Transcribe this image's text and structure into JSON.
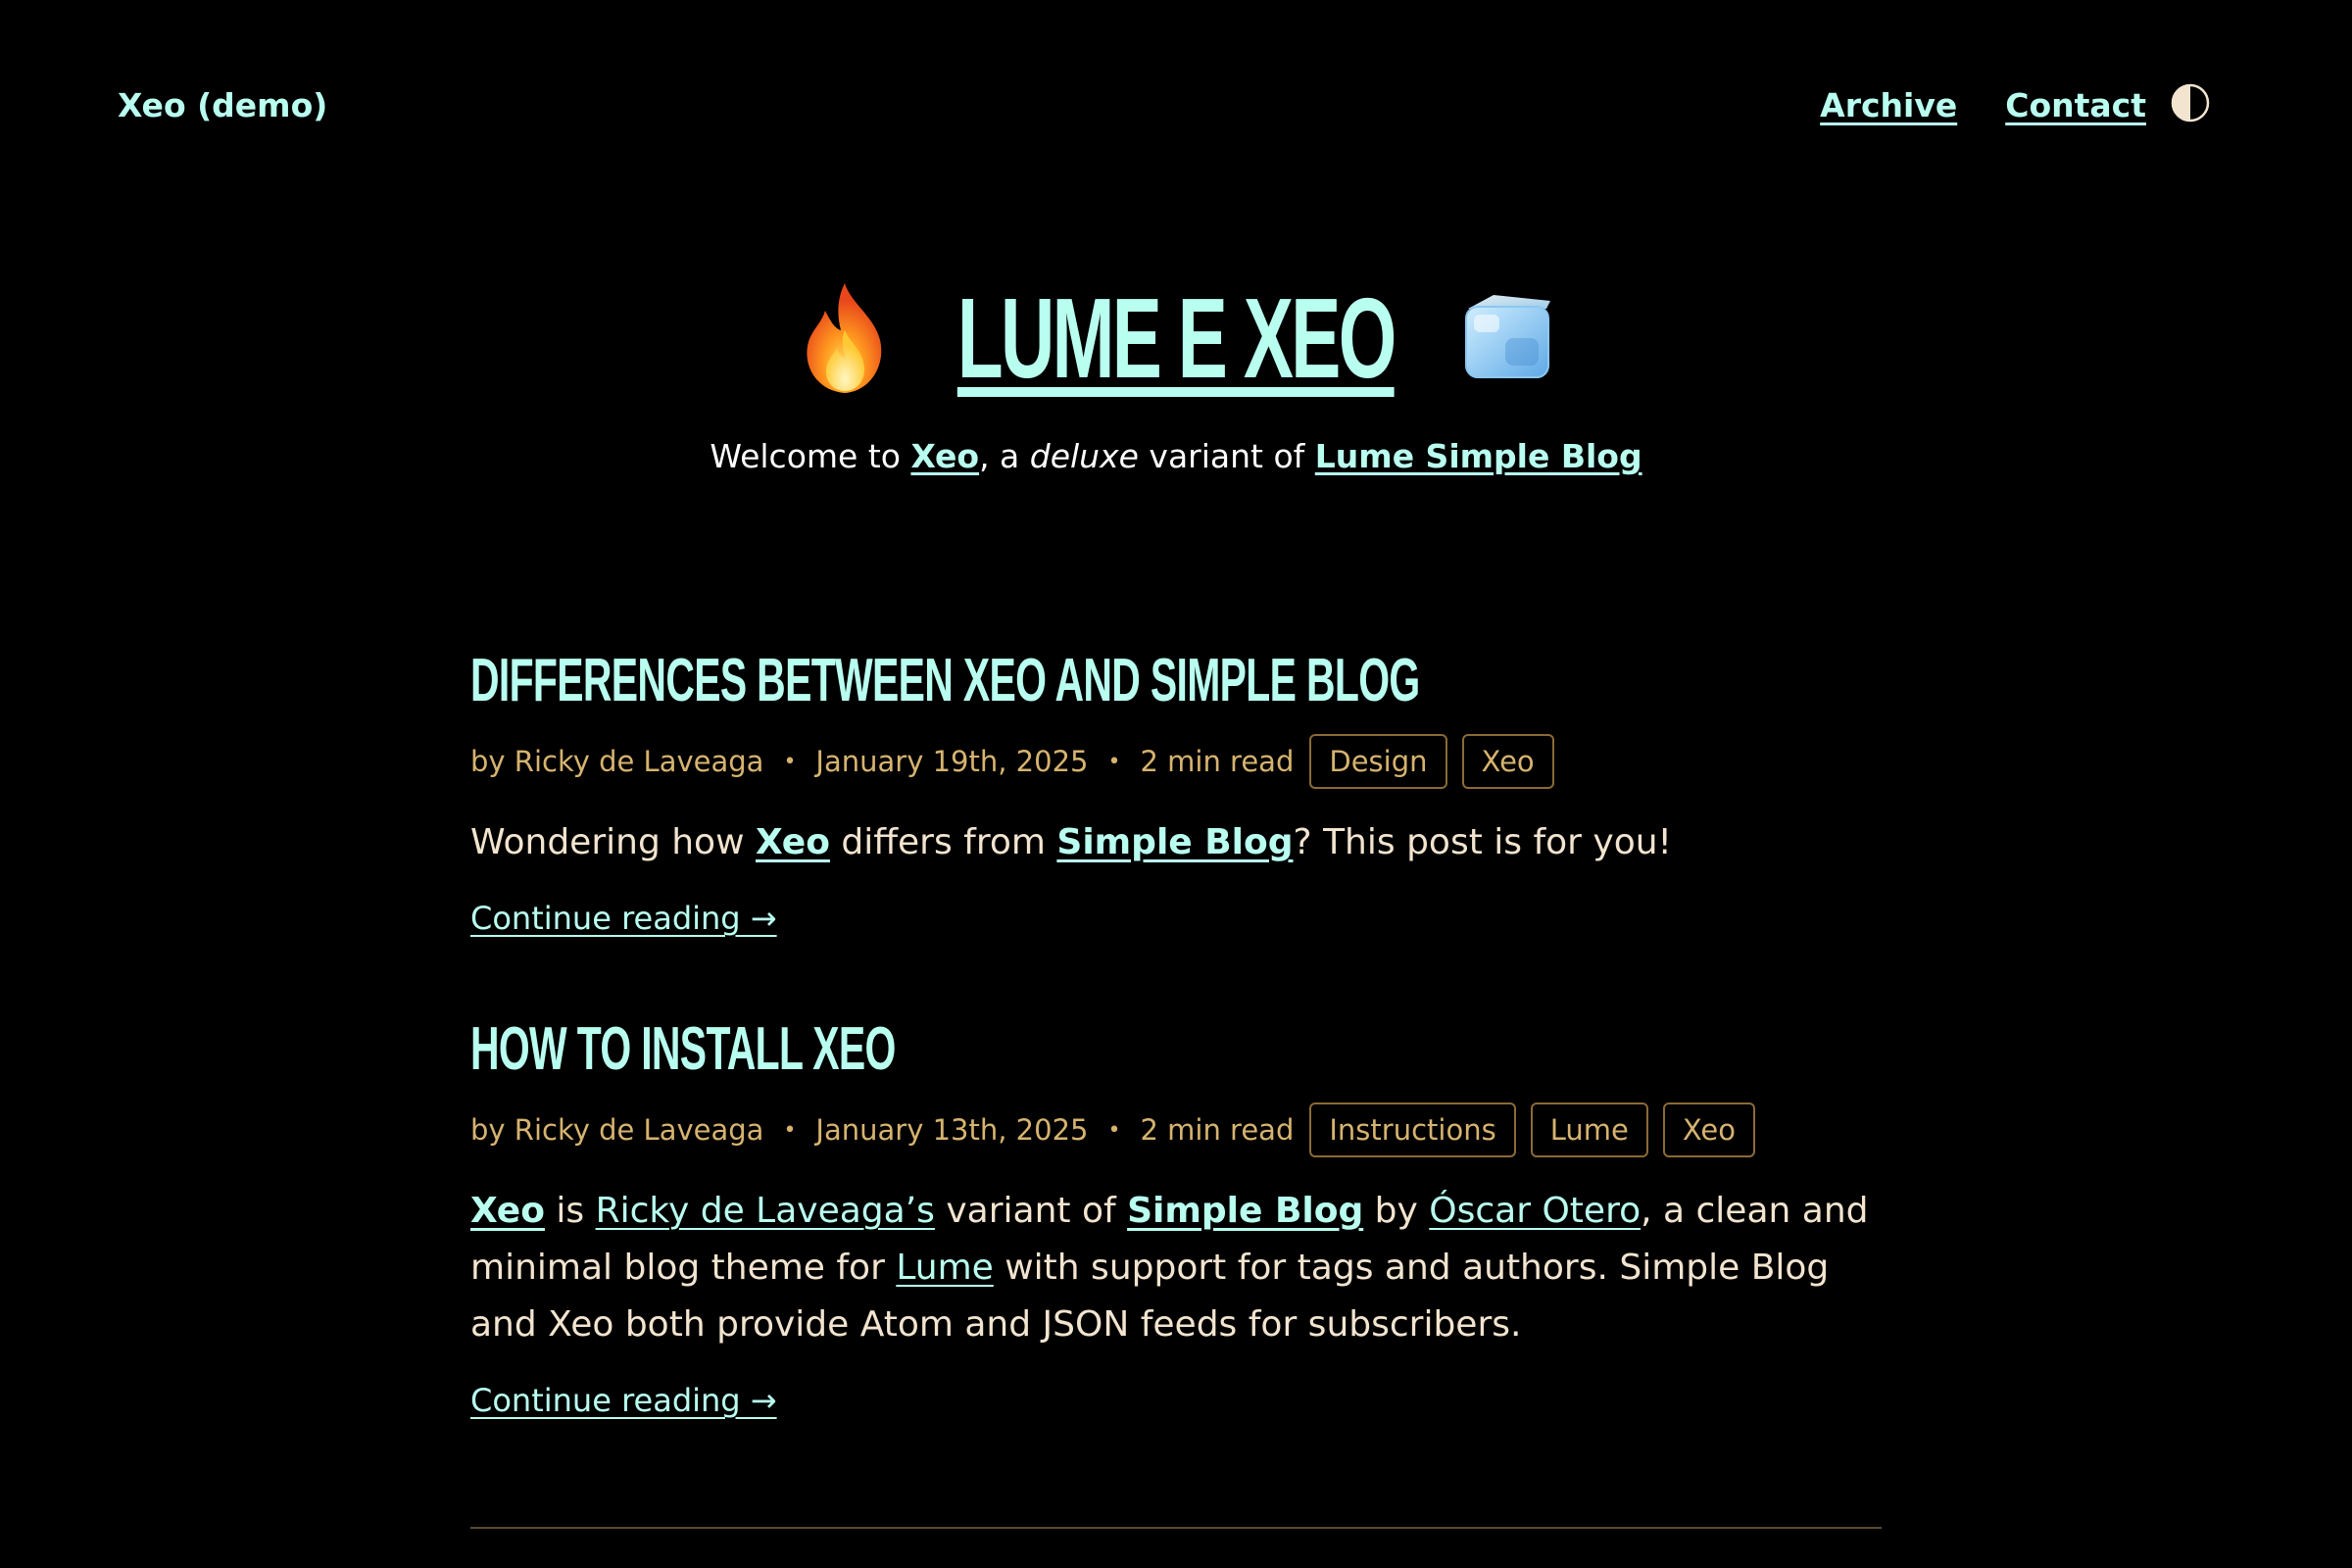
{
  "header": {
    "site_name": "Xeo (demo)",
    "nav": [
      {
        "label": "Archive"
      },
      {
        "label": "Contact"
      }
    ],
    "theme_toggle_icon": "half-circle-contrast-icon"
  },
  "hero": {
    "title": "LUME E XEO",
    "left_icon": "fire-emoji-icon",
    "right_icon": "ice-cube-emoji-icon",
    "sub_pre": "Welcome to ",
    "sub_link1": "Xeo",
    "sub_mid1": ", a ",
    "sub_em": "deluxe",
    "sub_mid2": " variant of ",
    "sub_link2": "Lume Simple Blog"
  },
  "posts": [
    {
      "title": "DIFFERENCES BETWEEN XEO AND SIMPLE BLOG",
      "author": "by Ricky de Laveaga",
      "date": "January 19th, 2025",
      "read_time": "2 min read",
      "tags": [
        "Design",
        "Xeo"
      ],
      "body": {
        "t1": "Wondering how ",
        "l1": "Xeo",
        "t2": " differs from ",
        "l2": "Simple Blog",
        "t3": "? This post is for you!"
      },
      "continue": "Continue reading →"
    },
    {
      "title": "HOW TO INSTALL XEO",
      "author": "by Ricky de Laveaga",
      "date": "January 13th, 2025",
      "read_time": "2 min read",
      "tags": [
        "Instructions",
        "Lume",
        "Xeo"
      ],
      "body": {
        "l1": "Xeo",
        "t1": " is ",
        "l2": "Ricky de Laveaga’s",
        "t2": " variant of ",
        "l3": "Simple Blog",
        "t3": " by ",
        "l4": "Óscar Otero",
        "t4": ", a clean and minimal blog theme for ",
        "l5": "Lume",
        "t5": " with support for tags and authors. Simple Blog and Xeo both provide Atom and JSON feeds for subscribers."
      },
      "continue": "Continue reading →"
    }
  ],
  "separator": "•",
  "colors": {
    "background": "#000000",
    "accent": "#b9fff0",
    "meta": "#d6b36f",
    "text": "#f2e4cf"
  }
}
